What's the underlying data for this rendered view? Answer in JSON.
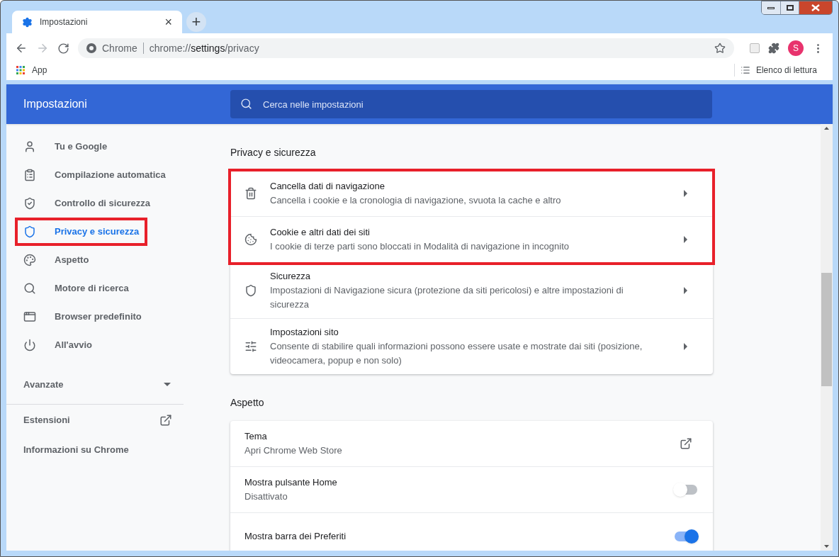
{
  "tab": {
    "title": "Impostazioni",
    "close": "×"
  },
  "new_tab": "+",
  "omnibox": {
    "site": "Chrome",
    "url_prefix": "chrome://",
    "url_host": "settings",
    "url_path": "/privacy"
  },
  "profile": {
    "initial": "S"
  },
  "bookmarks": {
    "apps": "App",
    "reading_list": "Elenco di lettura"
  },
  "header": {
    "title": "Impostazioni",
    "search_placeholder": "Cerca nelle impostazioni"
  },
  "sidebar": {
    "items": [
      {
        "label": "Tu e Google",
        "selected": false,
        "highlighted": false
      },
      {
        "label": "Compilazione automatica",
        "selected": false,
        "highlighted": false
      },
      {
        "label": "Controllo di sicurezza",
        "selected": false,
        "highlighted": false
      },
      {
        "label": "Privacy e sicurezza",
        "selected": true,
        "highlighted": true
      },
      {
        "label": "Aspetto",
        "selected": false,
        "highlighted": false
      },
      {
        "label": "Motore di ricerca",
        "selected": false,
        "highlighted": false
      },
      {
        "label": "Browser predefinito",
        "selected": false,
        "highlighted": false
      },
      {
        "label": "All'avvio",
        "selected": false,
        "highlighted": false
      }
    ],
    "advanced": {
      "label": "Avanzate",
      "expanded": false
    },
    "links": [
      {
        "label": "Estensioni",
        "external": true
      },
      {
        "label": "Informazioni su Chrome",
        "external": false
      }
    ]
  },
  "sections": [
    {
      "title": "Privacy e sicurezza",
      "rows": [
        {
          "kind": "nav",
          "title": "Cancella dati di navigazione",
          "subtitle": "Cancella i cookie e la cronologia di navigazione, svuota la cache e altro",
          "highlighted": true
        },
        {
          "kind": "nav",
          "title": "Cookie e altri dati dei siti",
          "subtitle": "I cookie di terze parti sono bloccati in Modalità di navigazione in incognito",
          "highlighted": true
        },
        {
          "kind": "nav",
          "title": "Sicurezza",
          "subtitle": "Impostazioni di Navigazione sicura (protezione da siti pericolosi) e altre impostazioni di sicurezza",
          "highlighted": false
        },
        {
          "kind": "nav",
          "title": "Impostazioni sito",
          "subtitle": "Consente di stabilire quali informazioni possono essere usate e mostrate dai siti (posizione, videocamera, popup e non solo)",
          "highlighted": false
        }
      ]
    },
    {
      "title": "Aspetto",
      "rows": [
        {
          "kind": "external",
          "title": "Tema",
          "subtitle": "Apri Chrome Web Store",
          "highlighted": false
        },
        {
          "kind": "toggle",
          "title": "Mostra pulsante Home",
          "subtitle": "Disattivato",
          "on": false,
          "highlighted": false
        },
        {
          "kind": "toggle",
          "title": "Mostra barra dei Preferiti",
          "on": true,
          "highlighted": false
        }
      ]
    }
  ]
}
